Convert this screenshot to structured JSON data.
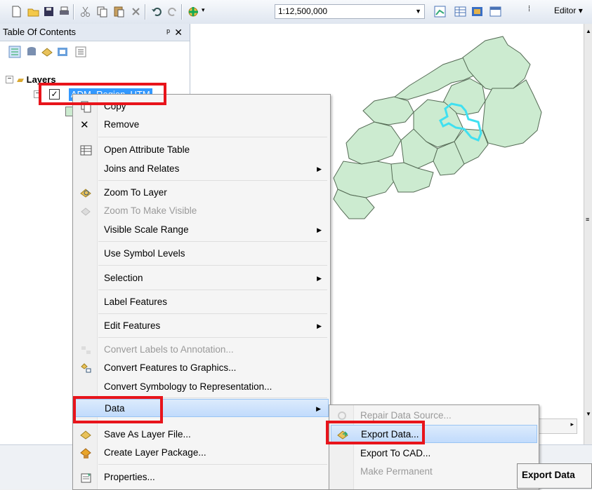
{
  "toolbar": {
    "scale": "1:12,500,000",
    "editor_label": "Editor"
  },
  "toc": {
    "title": "Table Of Contents",
    "layers_label": "Layers",
    "layer_name": "ADM_Region_UTM"
  },
  "context_menu": {
    "items": [
      {
        "label": "Copy",
        "icon": "copy-icon"
      },
      {
        "label": "Remove",
        "icon": "remove-x-icon"
      },
      {
        "label": "Open Attribute Table",
        "icon": "table-icon"
      },
      {
        "label": "Joins and Relates",
        "submenu": true
      },
      {
        "label": "Zoom To Layer",
        "icon": "zoom-layer-icon"
      },
      {
        "label": "Zoom To Make Visible",
        "icon": "zoom-visible-icon",
        "disabled": true
      },
      {
        "label": "Visible Scale Range",
        "submenu": true
      },
      {
        "label": "Use Symbol Levels"
      },
      {
        "label": "Selection",
        "submenu": true
      },
      {
        "label": "Label Features"
      },
      {
        "label": "Edit Features",
        "submenu": true
      },
      {
        "label": "Convert Labels to Annotation...",
        "icon": "convert-labels-icon",
        "disabled": true
      },
      {
        "label": "Convert Features to Graphics...",
        "icon": "convert-graphics-icon"
      },
      {
        "label": "Convert Symbology to Representation..."
      },
      {
        "label": "Data",
        "submenu": true,
        "highlighted": true
      },
      {
        "label": "Save As Layer File...",
        "icon": "layer-file-icon"
      },
      {
        "label": "Create Layer Package...",
        "icon": "layer-package-icon"
      },
      {
        "label": "Properties...",
        "icon": "properties-icon"
      }
    ]
  },
  "data_submenu": {
    "items": [
      {
        "label": "Repair Data Source...",
        "icon": "repair-icon",
        "disabled": true
      },
      {
        "label": "Export Data...",
        "icon": "export-data-icon",
        "highlighted": true
      },
      {
        "label": "Export To CAD..."
      },
      {
        "label": "Make Permanent",
        "disabled": true
      }
    ]
  },
  "tooltip": "Export Data",
  "colors": {
    "highlight_box": "#e8141b",
    "map_fill": "#ccebd0",
    "selection_outline": "#40e0f0"
  }
}
